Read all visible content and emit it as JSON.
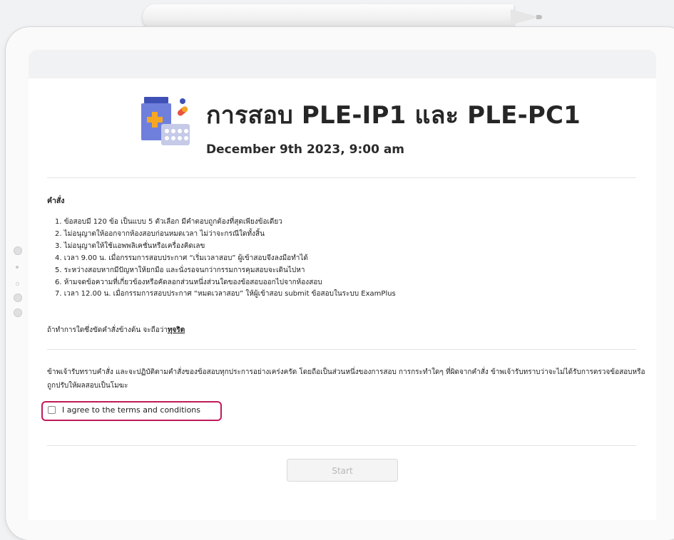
{
  "exam": {
    "title": "การสอบ PLE-IP1 และ PLE-PC1",
    "datetime": "December 9th 2023, 9:00 am"
  },
  "instructions": {
    "heading": "คำสั่ง",
    "rules": [
      "1. ข้อสอบมี 120 ข้อ เป็นแบบ 5 ตัวเลือก มีคำตอบถูกต้องที่สุดเพียงข้อเดียว",
      "2. ไม่อนุญาตให้ออกจากห้องสอบก่อนหมดเวลา ไม่ว่าจะกรณีใดทั้งสิ้น",
      "3. ไม่อนุญาตให้ใช้แอพพลิเคชั่นหรือเครื่องคิดเลข",
      "4. เวลา 9.00 น. เมื่อกรรมการสอบประกาศ “เริ่มเวลาสอบ” ผู้เข้าสอบจึงลงมือทำได้",
      "5. ระหว่างสอบหากมีปัญหาให้ยกมือ และนั่งรอจนกว่ากรรมการคุมสอบจะเดินไปหา",
      "6. ห้ามจดข้อความที่เกี่ยวข้องหรือคัดลอกส่วนหนึ่งส่วนใดของข้อสอบออกไปจากห้องสอบ",
      "7. เวลา 12.00 น. เมื่อกรรมการสอบประกาศ “หมดเวลาสอบ” ให้ผู้เข้าสอบ submit  ข้อสอบในระบบ ExamPlus"
    ],
    "warning_prefix": "ถ้าทำการใดซึ่งขัดคำสั่งข้างต้น จะถือว่า",
    "warning_strong": "ทุจริต"
  },
  "agreement": {
    "text": "ข้าพเจ้ารับทราบคำสั่ง และจะปฏิบัติตามคำสั่งของข้อสอบทุกประการอย่างเคร่งครัด โดยถือเป็นส่วนหนึ่งของการสอบ การกระทำใดๆ ที่ผิดจากคำสั่ง ข้าพเจ้ารับทราบว่าจะไม่ได้รับการตรวจข้อสอบหรือถูกปรับให้ผลสอบเป็นโมฆะ",
    "checkbox_label": "I agree to the terms and conditions",
    "checked": false
  },
  "actions": {
    "start_label": "Start"
  },
  "icons": {
    "logo": "medicine-bottle-pills-icon"
  },
  "colors": {
    "highlight": "#c2185b",
    "bottle_cap": "#3f51b5",
    "bottle_body": "#6f7fdc",
    "cross": "#f5a623",
    "capsule": "#e8533f",
    "blister": "#c5cae9"
  }
}
